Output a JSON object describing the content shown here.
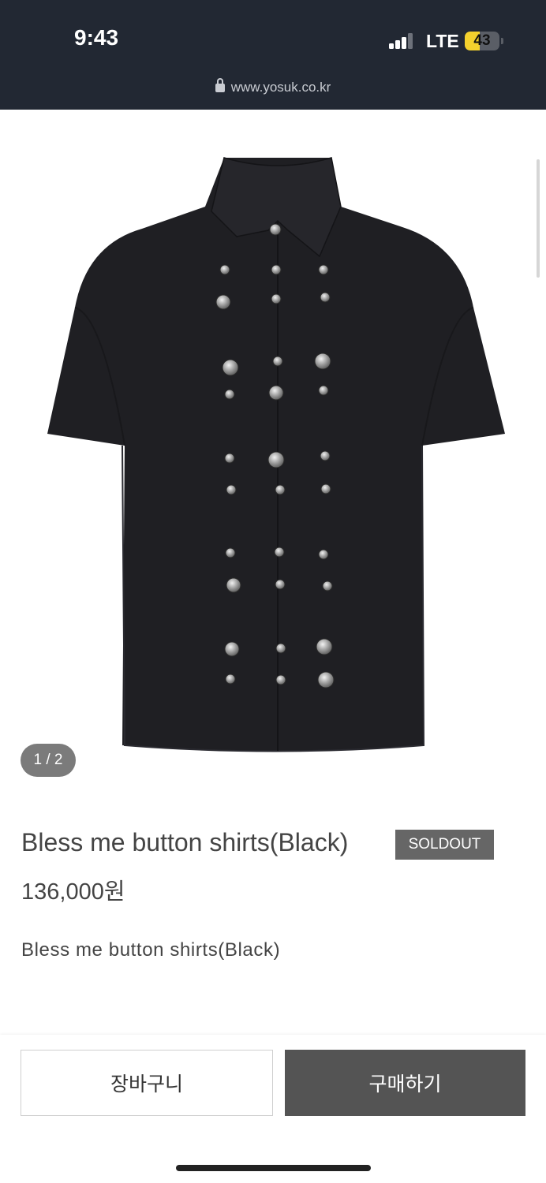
{
  "status_bar": {
    "time": "9:43",
    "network": "LTE",
    "battery": "43",
    "battery_level": 0.43,
    "signal_bars": 3,
    "signal_total": 4,
    "url": "www.yosuk.co.kr",
    "colors": {
      "background": "#222833",
      "battery_fill": "#f4d12d"
    }
  },
  "product": {
    "image_counter": "1 / 2",
    "title": "Bless me button shirts(Black)",
    "badge": "SOLDOUT",
    "price": "136,000원",
    "description": "Bless me button shirts(Black)"
  },
  "actions": {
    "cart_label": "장바구니",
    "buy_label": "구매하기"
  },
  "icons": {
    "lock": "lock-icon",
    "signal": "cellular-signal-icon",
    "battery": "battery-icon"
  }
}
